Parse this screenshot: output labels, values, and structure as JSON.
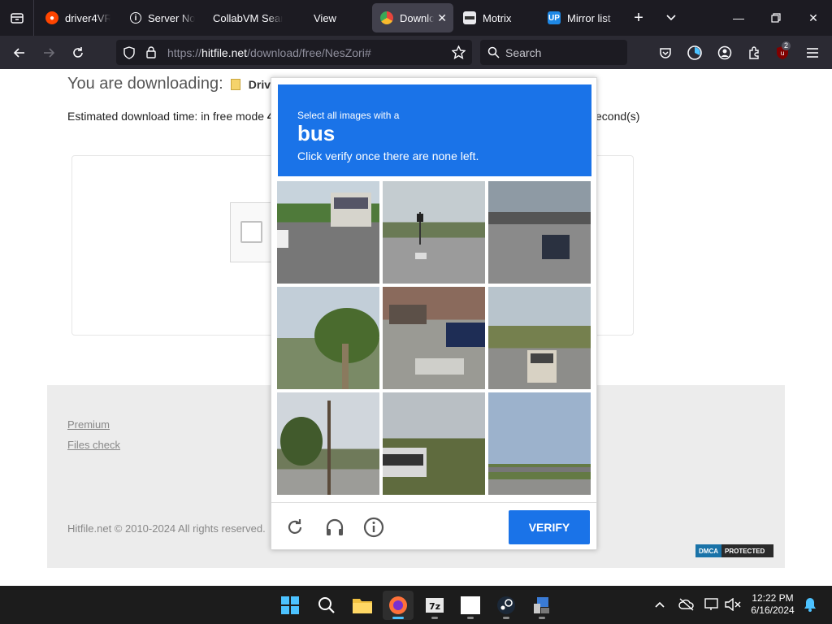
{
  "browser": {
    "tabs": [
      {
        "title": "driver4VR",
        "favicon": "reddit-icon",
        "color": "#ff4500"
      },
      {
        "title": "Server Not",
        "favicon": "info-icon",
        "color": "#fbfbfe"
      },
      {
        "title": "CollabVM Sear",
        "favicon": "",
        "color": ""
      },
      {
        "title": "View",
        "favicon": "",
        "color": ""
      },
      {
        "title": "Downlo",
        "favicon": "chrome-like-icon",
        "color": "#e8453c",
        "active": true
      },
      {
        "title": "Motrix",
        "favicon": "motrix-icon",
        "color": "#ffffff"
      },
      {
        "title": "Mirror list",
        "favicon": "up-icon",
        "color": "#1e88e5"
      }
    ],
    "url_prefix": "https://",
    "url_host": "hitfile.net",
    "url_path": "/download/free/NesZori#",
    "search_placeholder": "Search",
    "extensions_badge": "2"
  },
  "page": {
    "heading": "You are downloading:",
    "file_name": "Drive",
    "estimate_text": "Estimated download time: in free mode",
    "estimate_value": "4",
    "estimate_suffix": "econd(s)",
    "footer_links": [
      "Premium",
      "Files check"
    ],
    "copyright": "Hitfile.net © 2010-2024 All rights reserved.",
    "dmca_left": "DMCA",
    "dmca_right": "PROTECTED"
  },
  "captcha": {
    "line1": "Select all images with a",
    "target": "bus",
    "line3": "Click verify once there are none left.",
    "verify_label": "VERIFY",
    "accent": "#1a73e8"
  },
  "taskbar": {
    "apps": [
      "start-icon",
      "search-icon",
      "file-explorer-icon",
      "firefox-icon",
      "7zip-icon",
      "blank-app-icon",
      "steam-icon",
      "app-icon"
    ],
    "time": "12:22 PM",
    "date": "6/16/2024"
  }
}
